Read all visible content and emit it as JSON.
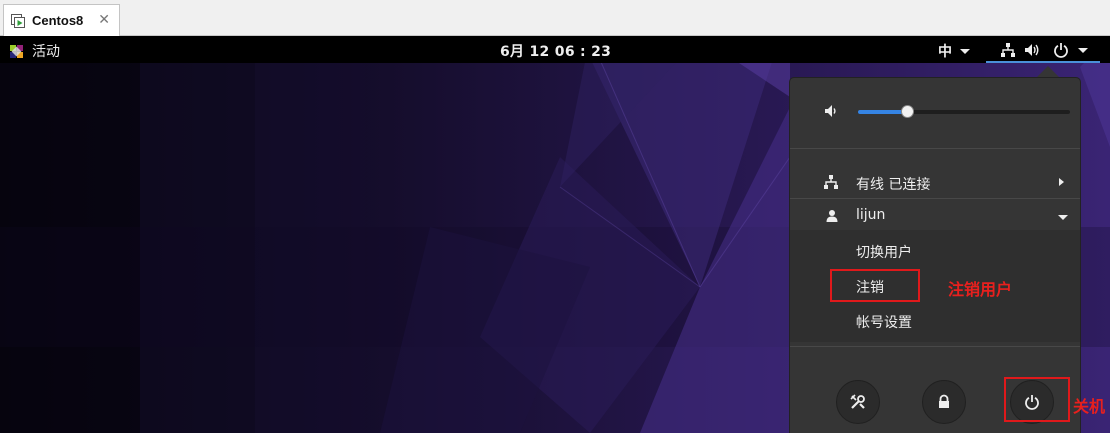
{
  "vm": {
    "tab_title": "Centos8",
    "close_glyph": "✕"
  },
  "topbar": {
    "activities_label": "活动",
    "clock": "6月 12  06 : 23",
    "input_method": "中",
    "indicators": [
      "network-icon",
      "volume-icon",
      "power-icon",
      "chevron-down-icon"
    ]
  },
  "menu": {
    "volume_level": 0.23,
    "network": {
      "label": "有线 已连接"
    },
    "user": {
      "name": "lijun",
      "items": [
        {
          "label": "切换用户"
        },
        {
          "label": "注销"
        },
        {
          "label": "帐号设置"
        }
      ]
    },
    "buttons": [
      "settings-icon",
      "lock-icon",
      "power-off-icon"
    ]
  },
  "annotations": {
    "logout_note": "注销用户",
    "shutdown_note": "关机",
    "color": "#e0191b"
  },
  "colors": {
    "accent": "#3584e4",
    "menu_bg": "#353535",
    "wallpaper": "#1a0f33"
  }
}
